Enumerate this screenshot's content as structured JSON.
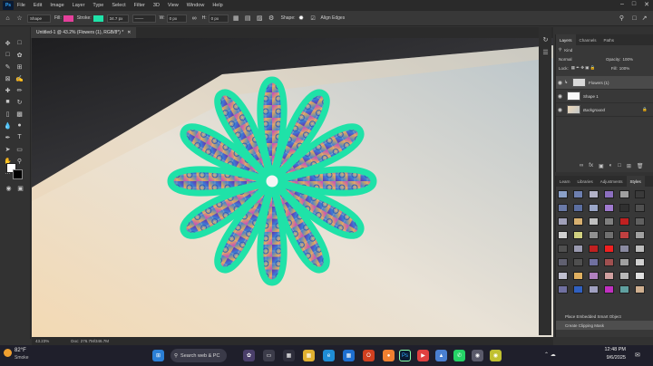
{
  "menubar": {
    "app_icon": "Ps",
    "items": [
      "File",
      "Edit",
      "Image",
      "Layer",
      "Type",
      "Select",
      "Filter",
      "3D",
      "View",
      "Window",
      "Help"
    ]
  },
  "options": {
    "mode": "Shape",
    "fill_label": "Fill:",
    "fill_color": "#e4409b",
    "stroke_label": "Stroke:",
    "stroke_color": "#1fe2a8",
    "stroke_width": "34.7 px",
    "w_label": "W:",
    "w_value": "0 px",
    "h_label": "H:",
    "h_value": "0 px",
    "shape_label": "Shape:",
    "align_edges": "Align Edges"
  },
  "document": {
    "tab_title": "Untitled-1 @ 43.2% (Flowers (1), RGB/8*) *",
    "zoom": "43.23%",
    "doc_info": "Doc: 276.7M/346.7M"
  },
  "layers_panel": {
    "tabs": [
      "Layers",
      "Channels",
      "Paths"
    ],
    "kind_filter": "Kind",
    "blend_mode": "Normal",
    "opacity_label": "Opacity:",
    "opacity_value": "100%",
    "lock_label": "Lock:",
    "fill_label": "Fill:",
    "fill_value": "100%",
    "layers": [
      {
        "name": "Flowers (1)",
        "selected": true
      },
      {
        "name": "Shape 1",
        "selected": false
      },
      {
        "name": "Background",
        "selected": false
      }
    ]
  },
  "styles_panel": {
    "tabs": [
      "Learn",
      "Libraries",
      "Adjustments",
      "Styles"
    ],
    "swatch_colors": [
      "#8aa0c8",
      "#6d7fb0",
      "#b3b3c8",
      "#8c6fc0",
      "#a0a0a0",
      "#3a3a3a",
      "#6a7aa8",
      "#5b6ea0",
      "#9aa6c8",
      "#a07ad0",
      "#303030",
      "#505050",
      "#a0a0b8",
      "#d8b070",
      "#c0c0c0",
      "#808080",
      "#c02020",
      "#606060",
      "#d0d0d0",
      "#d0d080",
      "#909090",
      "#707070",
      "#c04040",
      "#a0a0a0",
      "#505050",
      "#9a9ab0",
      "#c02020",
      "#f02020",
      "#8a8aa0",
      "#bdbdbd",
      "#606070",
      "#505050",
      "#7070a0",
      "#a05050",
      "#a0a0a0",
      "#d0d0d0",
      "#c0c0d0",
      "#e0b060",
      "#b080c0",
      "#d0a0a0",
      "#b8b8b8",
      "#e0e0e0",
      "#7070a0",
      "#3060c0",
      "#a0a0c0",
      "#c030c0",
      "#60a0a0",
      "#d0b090"
    ]
  },
  "history_panel": {
    "items": [
      "Place Embedded Smart Object",
      "Create Clipping Mask"
    ]
  },
  "taskbar": {
    "weather_temp": "82°F",
    "weather_text": "Smoke",
    "search_placeholder": "Search web & PC",
    "time": "12:48 PM",
    "date": "9/6/2025"
  },
  "colors": {
    "accent": "#31a8ff",
    "stroke_teal": "#1fe2a8",
    "fill_pink": "#e4409b"
  }
}
